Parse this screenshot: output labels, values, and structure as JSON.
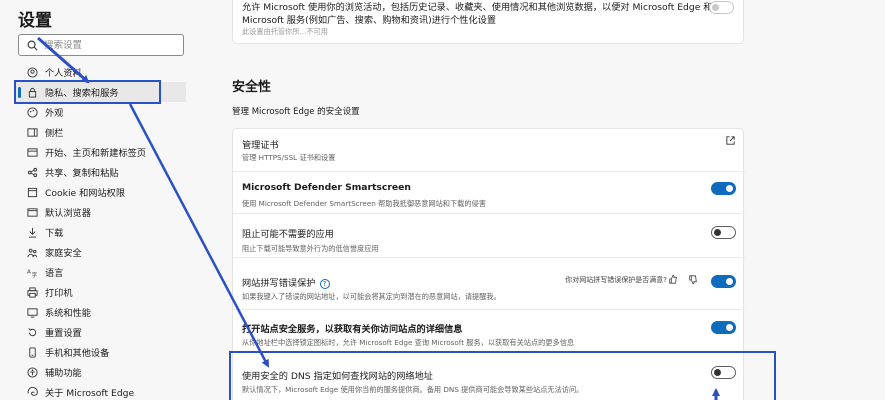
{
  "sidebar": {
    "title": "设置",
    "search_placeholder": "搜索设置",
    "items": [
      {
        "label": "个人资料",
        "icon": "profile-icon"
      },
      {
        "label": "隐私、搜索和服务",
        "icon": "lock-icon",
        "active": true
      },
      {
        "label": "外观",
        "icon": "appearance-icon"
      },
      {
        "label": "侧栏",
        "icon": "sidebar-icon"
      },
      {
        "label": "开始、主页和新建标签页",
        "icon": "home-icon"
      },
      {
        "label": "共享、复制和粘贴",
        "icon": "share-icon"
      },
      {
        "label": "Cookie 和网站权限",
        "icon": "cookie-icon"
      },
      {
        "label": "默认浏览器",
        "icon": "browser-icon"
      },
      {
        "label": "下载",
        "icon": "download-icon"
      },
      {
        "label": "家庭安全",
        "icon": "family-icon"
      },
      {
        "label": "语言",
        "icon": "language-icon"
      },
      {
        "label": "打印机",
        "icon": "printer-icon"
      },
      {
        "label": "系统和性能",
        "icon": "system-icon"
      },
      {
        "label": "重置设置",
        "icon": "reset-icon"
      },
      {
        "label": "手机和其他设备",
        "icon": "phone-icon"
      },
      {
        "label": "辅助功能",
        "icon": "accessibility-icon"
      },
      {
        "label": "关于 Microsoft Edge",
        "icon": "edge-icon"
      }
    ]
  },
  "top_card": {
    "title_line1": "允许 Microsoft 使用你的浏览活动，包括历史记录、收藏夹、使用情况和其他浏览数据，以便对 Microsoft Edge 和",
    "title_line2": "Microsoft 服务(例如广告、搜索、购物和资讯)进行个性化设置",
    "desc": "此设置由托管你所...不可用"
  },
  "security": {
    "title": "安全性",
    "subtitle": "管理 Microsoft Edge 的安全设置",
    "rows": [
      {
        "title": "管理证书",
        "desc": "管理 HTTPS/SSL 证书和设置",
        "control": "external-link"
      },
      {
        "title": "Microsoft Defender Smartscreen",
        "desc": "使用 Microsoft Defender SmartScreen 帮助我抵御恶意网站和下载的侵害",
        "control": "toggle",
        "state": "on"
      },
      {
        "title": "阻止可能不需要的应用",
        "desc": "阻止下载可能导致意外行为的低信誉度应用",
        "control": "toggle",
        "state": "off"
      },
      {
        "title": "网站拼写错误保护",
        "desc": "如果我键入了错误的网站地址，以可能会将其定向到潜在的恶意网站，请提醒我。",
        "control": "toggle",
        "state": "on",
        "feedback": "你对网站拼写错误保护是否满意?"
      },
      {
        "title": "打开站点安全服务，以获取有关你访问站点的详细信息",
        "desc": "从你地址栏中选择锁定图标时，允许 Microsoft Edge 查询 Microsoft 服务，以获取有关站点的更多信息",
        "control": "toggle",
        "state": "on"
      },
      {
        "title": "使用安全的 DNS 指定如何查找网站的网络地址",
        "desc": "默认情况下，Microsoft Edge 使用你当前的服务提供商。备用 DNS 提供商可能会导致某些站点无法访问。",
        "control": "toggle",
        "state": "off"
      }
    ]
  },
  "colors": {
    "accent": "#0f6cbd",
    "annotation": "#2b50c6"
  }
}
